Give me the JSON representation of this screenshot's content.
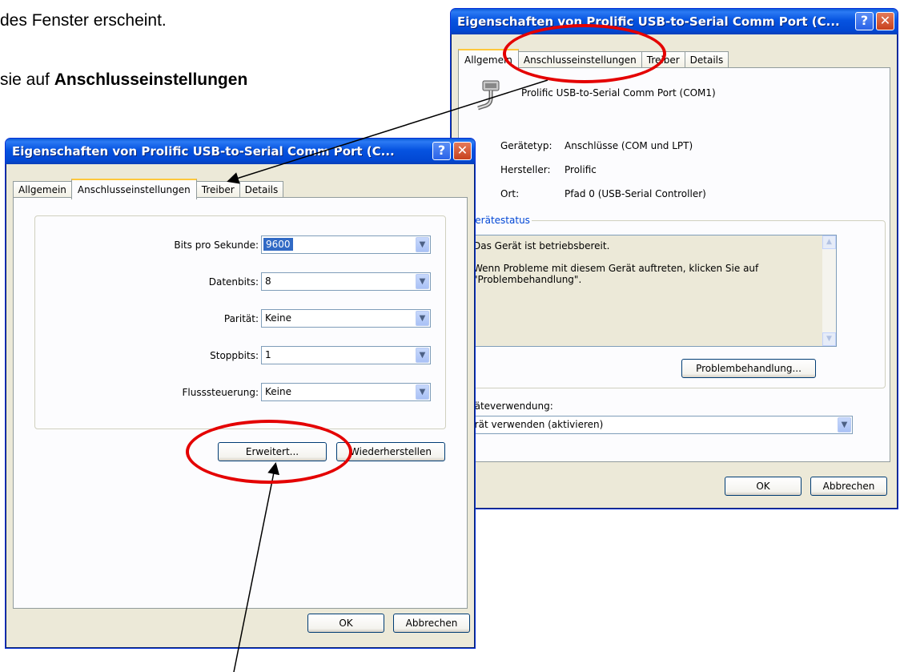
{
  "document": {
    "line1": "des Fenster erscheint.",
    "line2_prefix": "sie auf ",
    "line2_bold": "Anschlusseinstellungen"
  },
  "window_front": {
    "title": "Eigenschaften von Prolific USB-to-Serial Comm Port (C...",
    "help_glyph": "?",
    "close_glyph": "✕",
    "tabs": [
      "Allgemein",
      "Anschlusseinstellungen",
      "Treiber",
      "Details"
    ],
    "active_tab": "Anschlusseinstellungen",
    "fields": [
      {
        "label": "Bits pro Sekunde:",
        "value": "9600"
      },
      {
        "label": "Datenbits:",
        "value": "8"
      },
      {
        "label": "Parität:",
        "value": "Keine"
      },
      {
        "label": "Stoppbits:",
        "value": "1"
      },
      {
        "label": "Flusssteuerung:",
        "value": "Keine"
      }
    ],
    "advanced_button": "Erweitert...",
    "restore_button": "Wiederherstellen",
    "ok_button": "OK",
    "cancel_button": "Abbrechen"
  },
  "window_back": {
    "title": "Eigenschaften von Prolific USB-to-Serial Comm Port (C...",
    "help_glyph": "?",
    "close_glyph": "✕",
    "tabs": [
      "Allgemein",
      "Anschlusseinstellungen",
      "Treiber",
      "Details"
    ],
    "active_tab": "Allgemein",
    "device_name": "Prolific USB-to-Serial Comm Port (COM1)",
    "device_icon": "serial-port-icon",
    "props": [
      {
        "label": "Gerätetyp:",
        "value": "Anschlüsse (COM und LPT)"
      },
      {
        "label": "Hersteller:",
        "value": "Prolific"
      },
      {
        "label": "Ort:",
        "value": "Pfad 0 (USB-Serial Controller)"
      }
    ],
    "status_group_title": "Gerätestatus",
    "status_line1": "Das Gerät ist betriebsbereit.",
    "status_line2": "Wenn Probleme mit diesem Gerät auftreten, klicken Sie auf",
    "status_line3": "\"Problembehandlung\".",
    "troubleshoot_button": "Problembehandlung...",
    "usage_label": "Geräteverwendung:",
    "usage_value": "Gerät verwenden (aktivieren)",
    "ok_button": "OK",
    "cancel_button": "Abbrechen"
  },
  "annotation_color": "#e40000"
}
